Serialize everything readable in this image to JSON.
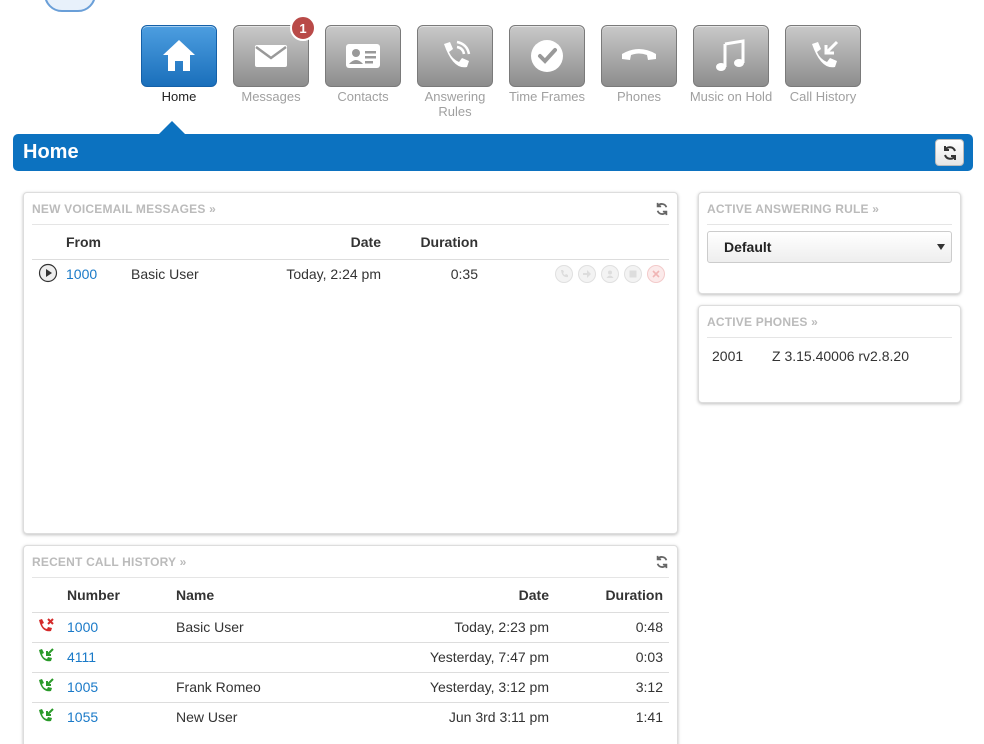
{
  "nav": {
    "items": [
      {
        "label": "Home",
        "icon": "home-icon",
        "active": true
      },
      {
        "label": "Messages",
        "icon": "envelope-icon",
        "badge": "1"
      },
      {
        "label": "Contacts",
        "icon": "contact-card-icon"
      },
      {
        "label": "Answering Rules",
        "icon": "phone-ringing-icon"
      },
      {
        "label": "Time Frames",
        "icon": "clock-check-icon"
      },
      {
        "label": "Phones",
        "icon": "handset-icon"
      },
      {
        "label": "Music on Hold",
        "icon": "music-note-icon"
      },
      {
        "label": "Call History",
        "icon": "call-history-icon"
      }
    ]
  },
  "page": {
    "title": "Home"
  },
  "voicemail": {
    "title": "NEW VOICEMAIL MESSAGES »",
    "headers": {
      "from": "From",
      "date": "Date",
      "duration": "Duration"
    },
    "rows": [
      {
        "number": "1000",
        "name": "Basic User",
        "date": "Today, 2:24 pm",
        "duration": "0:35"
      }
    ]
  },
  "answering_rule": {
    "title": "ACTIVE ANSWERING RULE »",
    "selected": "Default"
  },
  "active_phones": {
    "title": "ACTIVE PHONES »",
    "rows": [
      {
        "ext": "2001",
        "model": "Z 3.15.40006 rv2.8.20"
      }
    ]
  },
  "call_history": {
    "title": "RECENT CALL HISTORY »",
    "headers": {
      "number": "Number",
      "name": "Name",
      "date": "Date",
      "duration": "Duration"
    },
    "rows": [
      {
        "number": "1000",
        "name": "Basic User",
        "date": "Today, 2:23 pm",
        "duration": "0:48",
        "type": "missed"
      },
      {
        "number": "4111",
        "name": "",
        "date": "Yesterday, 7:47 pm",
        "duration": "0:03",
        "type": "incoming"
      },
      {
        "number": "1005",
        "name": "Frank Romeo",
        "date": "Yesterday, 3:12 pm",
        "duration": "3:12",
        "type": "incoming"
      },
      {
        "number": "1055",
        "name": "New User",
        "date": "Jun 3rd 3:11 pm",
        "duration": "1:41",
        "type": "incoming"
      }
    ]
  },
  "colors": {
    "primary": "#0c72c0",
    "missed": "#d42a2a",
    "incoming": "#2a9a2a",
    "link": "#1a7ac8"
  }
}
